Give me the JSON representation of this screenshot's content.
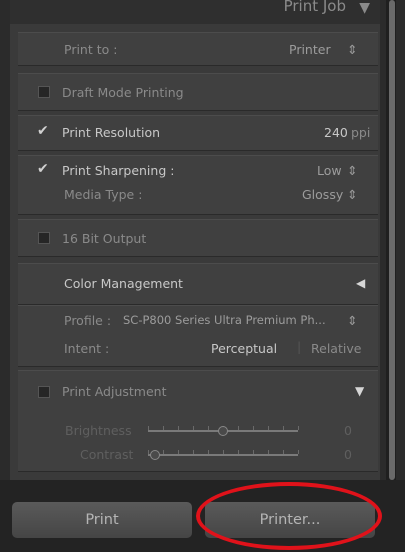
{
  "header": {
    "title": "Print Job"
  },
  "print_to": {
    "label": "Print to :",
    "value": "Printer",
    "stepper": "⇕"
  },
  "draft_mode": {
    "label": "Draft Mode Printing",
    "checked": false
  },
  "resolution": {
    "label": "Print Resolution",
    "checked": true,
    "value": "240",
    "unit": "ppi"
  },
  "sharpening": {
    "label": "Print Sharpening :",
    "checked": true,
    "value": "Low",
    "media_label": "Media Type :",
    "media_value": "Glossy"
  },
  "bit16": {
    "label": "16 Bit Output",
    "checked": false
  },
  "color_mgmt": {
    "title": "Color Management",
    "profile_label": "Profile :",
    "profile_value": "SC-P800 Series Ultra Premium Ph...",
    "intent_label": "Intent :",
    "intent_perceptual": "Perceptual",
    "intent_relative": "Relative"
  },
  "adjustment": {
    "label": "Print Adjustment",
    "checked": false,
    "brightness_label": "Brightness",
    "brightness_value": "0",
    "contrast_label": "Contrast",
    "contrast_value": "0"
  },
  "buttons": {
    "print": "Print",
    "printer": "Printer..."
  },
  "colors": {
    "annotation": "#e0121a"
  }
}
